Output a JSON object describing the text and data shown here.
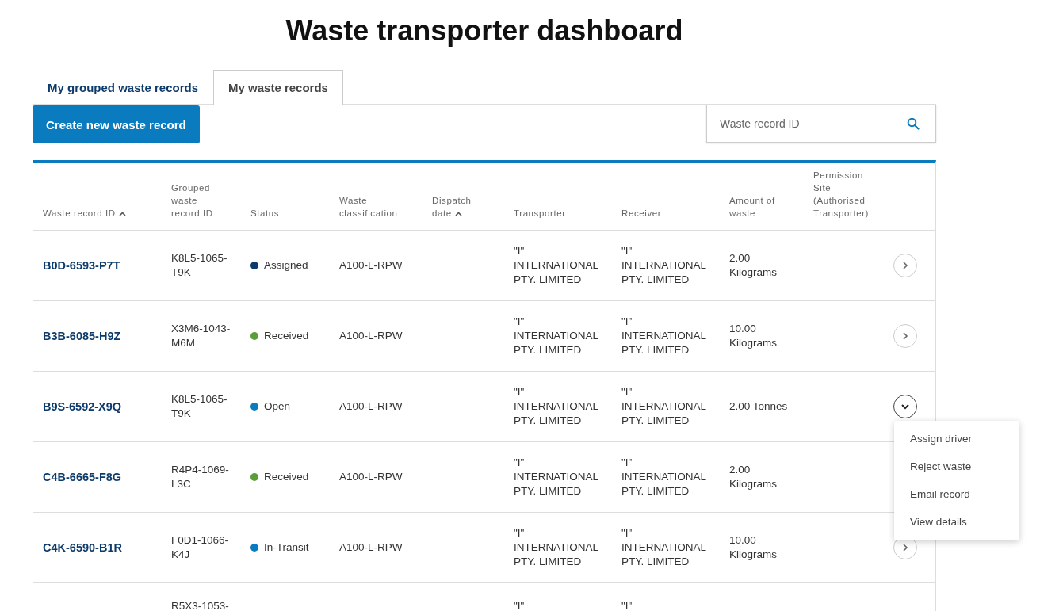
{
  "page_title": "Waste transporter dashboard",
  "tabs": [
    {
      "label": "My grouped waste records",
      "selected": false
    },
    {
      "label": "My waste records",
      "selected": true
    }
  ],
  "create_button": "Create new waste record",
  "search": {
    "placeholder": "Waste record ID"
  },
  "table": {
    "columns": [
      {
        "label": "Waste record ID",
        "sorted": true
      },
      {
        "label": "Grouped waste record ID",
        "sorted": false
      },
      {
        "label": "Status",
        "sorted": false
      },
      {
        "label": "Waste classification",
        "sorted": false
      },
      {
        "label": "Dispatch date",
        "sorted": true
      },
      {
        "label": "Transporter",
        "sorted": false
      },
      {
        "label": "Receiver",
        "sorted": false
      },
      {
        "label": "Amount of waste",
        "sorted": false
      },
      {
        "label": "Permission Site (Authorised Transporter)",
        "sorted": false
      }
    ],
    "rows": [
      {
        "id": "B0D-6593-P7T",
        "grouped_id": "K8L5-1065-T9K",
        "status": "Assigned",
        "color": "#0b3a6b",
        "classification": "A100-L-RPW",
        "transporter": [
          "\"I\"",
          "INTERNATIONAL PTY. LIMITED"
        ],
        "receiver": [
          "\"I\"",
          "INTERNATIONAL PTY. LIMITED"
        ],
        "amount": "2.00 Kilograms",
        "expanded": false
      },
      {
        "id": "B3B-6085-H9Z",
        "grouped_id": "X3M6-1043-M6M",
        "status": "Received",
        "color": "#5a9e3a",
        "classification": "A100-L-RPW",
        "transporter": [
          "\"I\"",
          "INTERNATIONAL PTY. LIMITED"
        ],
        "receiver": [
          "\"I\"",
          "INTERNATIONAL PTY. LIMITED"
        ],
        "amount": "10.00 Kilograms",
        "expanded": false
      },
      {
        "id": "B9S-6592-X9Q",
        "grouped_id": "K8L5-1065-T9K",
        "status": "Open",
        "color": "#0a7bbf",
        "classification": "A100-L-RPW",
        "transporter": [
          "\"I\"",
          "INTERNATIONAL PTY. LIMITED"
        ],
        "receiver": [
          "\"I\"",
          "INTERNATIONAL PTY. LIMITED"
        ],
        "amount": "2.00 Tonnes",
        "expanded": true
      },
      {
        "id": "C4B-6665-F8G",
        "grouped_id": "R4P4-1069-L3C",
        "status": "Received",
        "color": "#5a9e3a",
        "classification": "A100-L-RPW",
        "transporter": [
          "\"I\"",
          "INTERNATIONAL PTY. LIMITED"
        ],
        "receiver": [
          "\"I\"",
          "INTERNATIONAL PTY. LIMITED"
        ],
        "amount": "2.00 Kilograms"
      },
      {
        "id": "C4K-6590-B1R",
        "grouped_id": "F0D1-1066-K4J",
        "status": "In-Transit",
        "color": "#0a7bbf",
        "classification": "A100-L-RPW",
        "transporter": [
          "\"I\"",
          "INTERNATIONAL PTY. LIMITED"
        ],
        "receiver": [
          "\"I\"",
          "INTERNATIONAL PTY. LIMITED"
        ],
        "amount": "10.00 Kilograms",
        "expanded": false
      },
      {
        "grouped_id": "R5X3-1053-",
        "transporter": [
          "\"I\""
        ],
        "receiver": [
          "\"I\""
        ]
      }
    ]
  },
  "row_menu": [
    "Assign driver",
    "Reject waste",
    "Email record",
    "View details"
  ]
}
